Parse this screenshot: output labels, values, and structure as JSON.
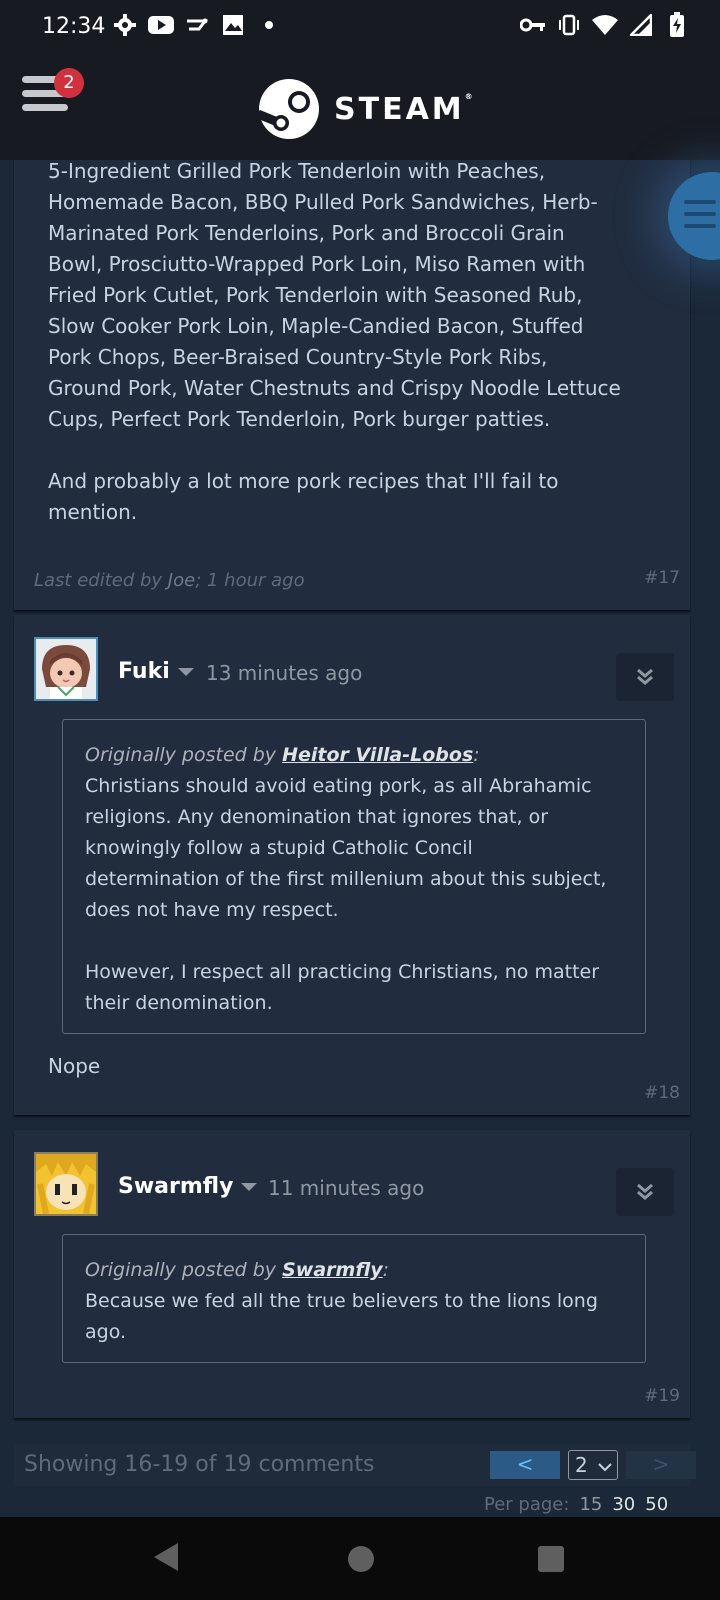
{
  "status_bar": {
    "time": "12:34",
    "left_icons": [
      "gear-icon",
      "youtube-icon",
      "app-icon",
      "gallery-icon",
      "dot-icon"
    ],
    "right_icons": [
      "vpn-key-icon",
      "vibrate-icon",
      "wifi-icon",
      "signal-icon",
      "battery-icon"
    ]
  },
  "header": {
    "menu_badge": "2",
    "logo_text": "STEAM",
    "logo_mark": "®"
  },
  "posts": [
    {
      "number": "#17",
      "body_lines": [
        "5-Ingredient Grilled Pork Tenderloin with Peaches,",
        "Homemade Bacon, BBQ Pulled Pork Sandwiches, Herb-",
        "Marinated Pork Tenderloins, Pork and Broccoli Grain",
        "Bowl, Prosciutto-Wrapped Pork Loin, Miso Ramen with",
        "Fried Pork Cutlet, Pork Tenderloin with Seasoned Rub,",
        "Slow Cooker Pork Loin, Maple-Candied Bacon, Stuffed",
        "Pork Chops, Beer-Braised Country-Style Pork Ribs,",
        "Ground Pork, Water Chestnuts and Crispy Noodle Lettuce",
        "Cups, Perfect Pork Tenderloin, Pork burger patties."
      ],
      "body_tail_lines": [
        "And probably a lot more pork recipes that I'll fail to",
        "mention."
      ],
      "edit_prefix": "Last edited by ",
      "edit_name": "Joe",
      "edit_suffix": "; 1 hour ago"
    },
    {
      "number": "#18",
      "author": "Fuki",
      "time": "13 minutes ago",
      "quote_prefix": "Originally posted by ",
      "quote_author": "Heitor Villa-Lobos",
      "quote_colon": ":",
      "quote_lines": [
        "Christians should avoid eating pork, as all Abrahamic",
        "religions. Any denomination that ignores that, or",
        "knowingly follow a stupid Catholic Concil",
        "determination of the first millenium about this subject,",
        "does not have my respect."
      ],
      "quote_lines_2": [
        "However, I respect all practicing Christians, no matter",
        "their denomination."
      ],
      "reply": "Nope"
    },
    {
      "number": "#19",
      "author": "Swarmfly",
      "time": "11 minutes ago",
      "quote_prefix": "Originally posted by ",
      "quote_author": "Swarmfly",
      "quote_colon": ":",
      "quote_lines": [
        "Because we fed all the true believers to the lions long",
        "ago."
      ]
    }
  ],
  "pagination": {
    "showing": "Showing 16-19 of 19 comments",
    "prev": "<",
    "page": "2",
    "next": ">",
    "per_page_label": "Per page:",
    "per_page_options": [
      "15",
      "30",
      "50"
    ]
  },
  "colors": {
    "background": "#1b2838",
    "card": "#212d3f",
    "header": "#171a21",
    "badge": "#d0313e",
    "link_blue": "#66c0f4"
  }
}
